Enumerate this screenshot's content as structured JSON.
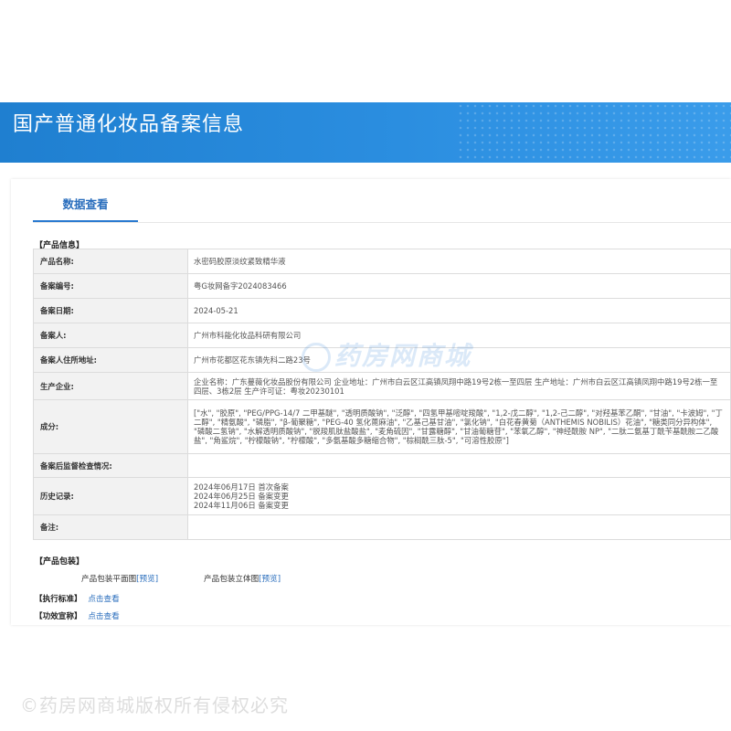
{
  "page_title": "国产普通化妆品备案信息",
  "tab_label": "数据查看",
  "product_info": {
    "section_title": "【产品信息】",
    "rows": [
      {
        "label": "产品名称:",
        "value": "水密码胶原淡纹紧致精华液"
      },
      {
        "label": "备案编号:",
        "value": "粤G妆网备字2024083466"
      },
      {
        "label": "备案日期:",
        "value": "2024-05-21"
      },
      {
        "label": "备案人:",
        "value": "广州市科能化妆品科研有限公司"
      },
      {
        "label": "备案人住所地址:",
        "value": "广州市花都区花东镇先科二路23号"
      },
      {
        "label": "生产企业:",
        "value": "企业名称：广东蔓薇化妆品股份有限公司 企业地址：广州市白云区江高镇凤翔中路19号2栋一至四层 生产地址：广州市白云区江高镇凤翔中路19号2栋一至四层、3栋2层 生产许可证：粤妆20230101"
      },
      {
        "label": "成分:",
        "value": "[\"水\", \"胶原\", \"PEG/PPG-14/7 二甲基醚\", \"透明质酸钠\", \"泛醇\", \"四氢甲基嘧啶羧酸\", \"1,2-戊二醇\", \"1,2-己二醇\", \"对羟基苯乙酮\", \"甘油\", \"卡波姆\", \"丁二醇\", \"精氨酸\", \"磷脂\", \"β-葡聚糖\", \"PEG-40 氢化蓖麻油\", \"乙基己基甘油\", \"氯化钠\", \"白花春黄菊（ANTHEMIS NOBILIS）花油\", \"糖类同分异构体\", \"磷酸二氢钠\", \"水解透明质酸钠\", \"脱羧肌肽盐酸盐\", \"麦角硫因\", \"甘露糖醇\", \"甘油葡糖苷\", \"苯氧乙醇\", \"神经酰胺 NP\", \"二肽二氨基丁酰苄基酰胺二乙酸盐\", \"角鲨烷\", \"柠檬酸钠\", \"柠檬酸\", \"多氨基酸多糖缩合物\", \"棕榈酰三肽-5\", \"可溶性胶原\"]"
      },
      {
        "label": "备案后监督检查情况:",
        "value": ""
      },
      {
        "label": "历史记录:",
        "value_lines": [
          "2024年06月17日 首次备案",
          "2024年06月25日 备案变更",
          "2024年11月06日 备案变更"
        ]
      },
      {
        "label": "备注:",
        "value": ""
      }
    ]
  },
  "packaging": {
    "section_title": "【产品包装】",
    "flat_label": "产品包装平面图",
    "flat_link": "[预览]",
    "solid_label": "产品包装立体图",
    "solid_link": "[预览]"
  },
  "standard": {
    "label": "【执行标准】",
    "link": "点击查看"
  },
  "efficacy": {
    "label": "【功效宣称】",
    "link": "点击查看"
  },
  "watermark_center": "药房网商城",
  "watermark_bottom": "©药房网商城版权所有侵权必究"
}
